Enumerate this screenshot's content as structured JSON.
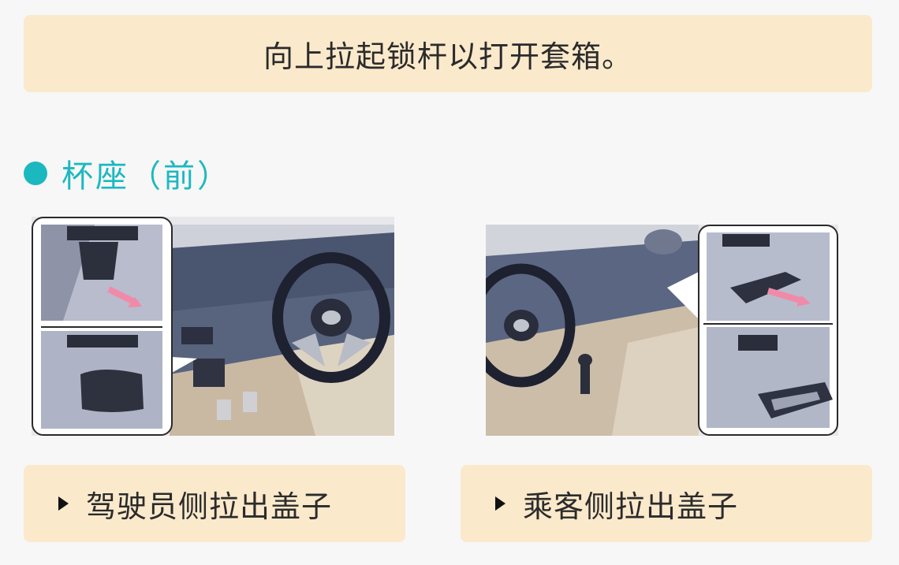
{
  "banner": {
    "text": "向上拉起锁杆以打开套箱。"
  },
  "section": {
    "title": "杯座（前）"
  },
  "captions": {
    "driver": "驾驶员侧拉出盖子",
    "passenger": "乘客侧拉出盖子"
  },
  "icons": {
    "bullet": "circle-bullet-icon",
    "caption_marker": "play-triangle-icon"
  },
  "colors": {
    "accent": "#1cb8c0",
    "panel": "#fbe9cc",
    "arrow": "#f08aa8"
  }
}
